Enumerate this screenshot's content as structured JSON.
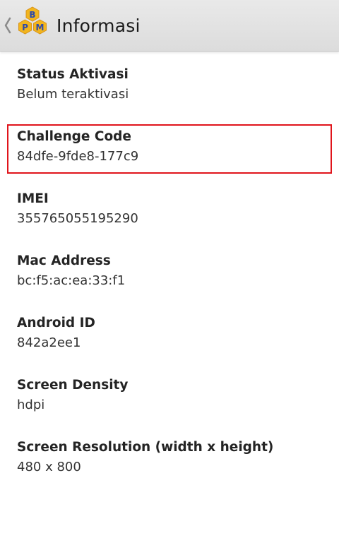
{
  "header": {
    "title": "Informasi",
    "logo_letters": [
      "B",
      "P",
      "M"
    ]
  },
  "items": [
    {
      "label": "Status Aktivasi",
      "value": "Belum teraktivasi"
    },
    {
      "label": "Challenge Code",
      "value": "84dfe-9fde8-177c9"
    },
    {
      "label": "IMEI",
      "value": "355765055195290"
    },
    {
      "label": "Mac Address",
      "value": "bc:f5:ac:ea:33:f1"
    },
    {
      "label": "Android ID",
      "value": "842a2ee1"
    },
    {
      "label": "Screen Density",
      "value": "hdpi"
    },
    {
      "label": "Screen Resolution (width x height)",
      "value": "480 x 800"
    }
  ],
  "colors": {
    "highlight": "#e0141b",
    "actionbar": "#dcdcdc",
    "logo_hex": "#f2b51d",
    "logo_letters": "#2f4aa8"
  }
}
